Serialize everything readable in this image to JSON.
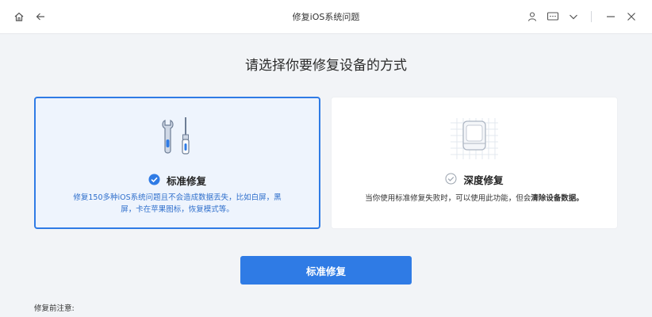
{
  "titlebar": {
    "title": "修复iOS系统问题",
    "icons": [
      "home-icon",
      "back-arrow-icon",
      "user-icon",
      "feedback-icon",
      "chevron-down-icon",
      "minimize-icon",
      "close-icon"
    ]
  },
  "main": {
    "heading": "请选择你要修复设备的方式",
    "cards": [
      {
        "title": "标准修复",
        "description": "修复150多种iOS系统问题且不会造成数据丢失，比如白屏，黑屏，卡在苹果图标，恢复模式等。",
        "selected": true,
        "icon": "tools-icon"
      },
      {
        "title": "深度修复",
        "description_prefix": "当你使用标准修复失败时，可以使用此功能，但会",
        "description_bold": "清除设备数据。",
        "selected": false,
        "icon": "device-icon"
      }
    ],
    "primary_button": "标准修复",
    "note_label": "修复前注意:"
  },
  "colors": {
    "accent": "#2f7be5",
    "selected_bg": "#eef4fd",
    "page_bg": "#f2f4f7"
  }
}
